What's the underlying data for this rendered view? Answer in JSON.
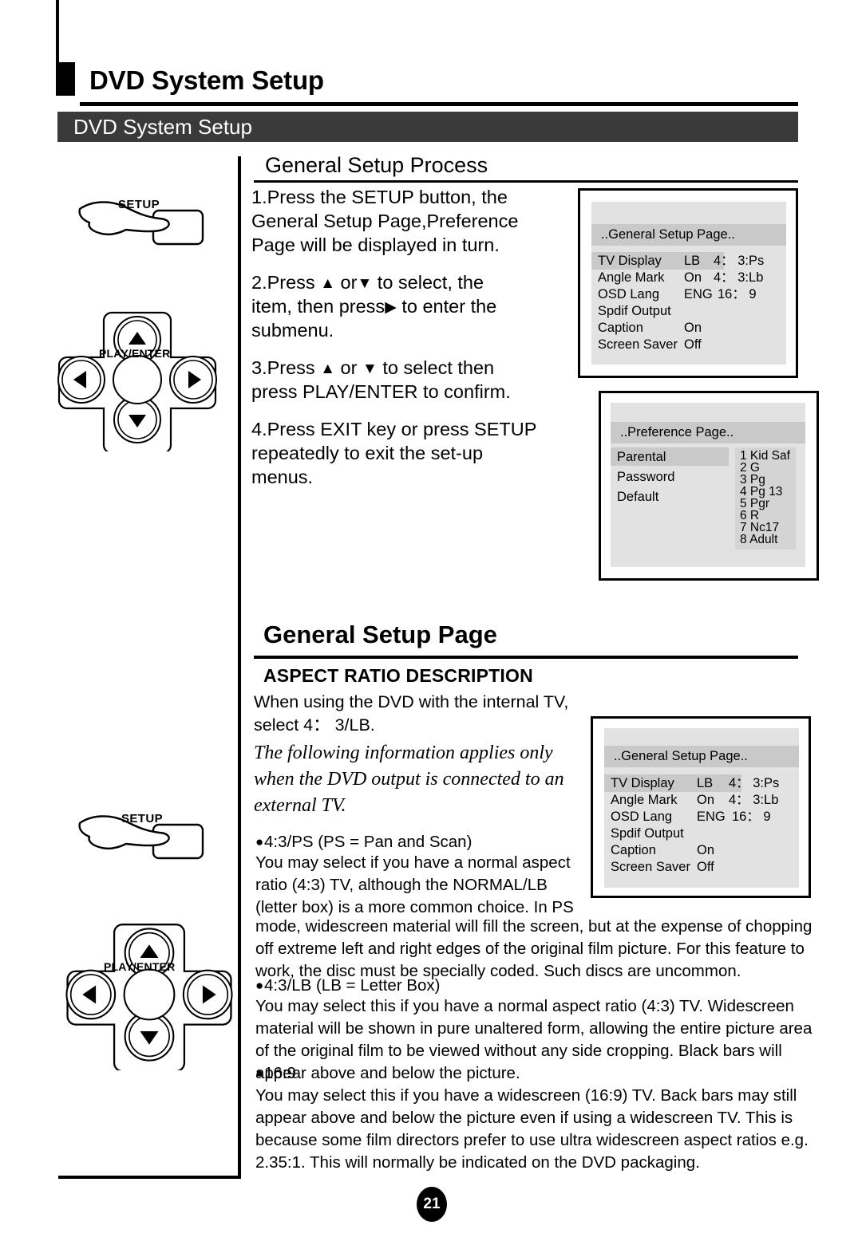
{
  "page": {
    "number": "21",
    "doc_title": "DVD System Setup",
    "title_bar_label": "DVD System Setup"
  },
  "process_section": {
    "heading": "General Setup Process",
    "steps": [
      {
        "id": "step-1",
        "line1": "1.Press the SETUP button, the",
        "line2": "General Setup Page,Preference",
        "line3": "Page  will be displayed in turn."
      },
      {
        "id": "step-2",
        "pre": "2.Press",
        "up": "▲",
        "or": "or",
        "down": "▼",
        "mid": "to select, the",
        "line2a": "item, then press",
        "right": "▶",
        "line2b": "to enter the",
        "line3": "submenu."
      },
      {
        "id": "step-3",
        "pre": "3.Press",
        "up": "▲",
        "or": "or",
        "down": "▼",
        "mid": "to select  then",
        "line2": "press PLAY/ENTER to confirm."
      },
      {
        "id": "step-4",
        "line1": "4.Press  EXIT key or press SETUP",
        "line2": "repeatedly  to  exit  the  set-up",
        "line3": "menus."
      }
    ]
  },
  "remote_top": {
    "setup_label": "SETUP",
    "dpad_label": "PLAY/ENTER",
    "up": "▲",
    "down": "▼",
    "left": "◀",
    "right": "▶"
  },
  "remote_bottom": {
    "setup_label": "SETUP",
    "dpad_label": "PLAY/ENTER",
    "up": "▲",
    "down": "▼",
    "left": "◀",
    "right": "▶"
  },
  "osd_general_1": {
    "title": "..General Setup Page..",
    "rows": [
      {
        "label": "TV Display",
        "value": "LB",
        "option": "4： 3:Ps",
        "highlight": true
      },
      {
        "label": "Angle Mark",
        "value": "On",
        "option": "4： 3:Lb",
        "highlight": false
      },
      {
        "label": "OSD Lang",
        "value": "ENG",
        "option": "16： 9",
        "highlight": false
      },
      {
        "label": "Spdif Output",
        "value": "",
        "option": "",
        "highlight": false
      },
      {
        "label": "Caption",
        "value": "On",
        "option": "",
        "highlight": false
      },
      {
        "label": "Screen Saver",
        "value": "Off",
        "option": "",
        "highlight": false
      }
    ]
  },
  "osd_preference": {
    "title": "..Preference Page..",
    "rows": [
      {
        "label": "Parental",
        "highlight": true
      },
      {
        "label": "Password",
        "highlight": false
      },
      {
        "label": "Default",
        "highlight": false
      }
    ],
    "ratings": [
      "1 Kid Saf",
      "2 G",
      "3 Pg",
      "4 Pg 13",
      "5 Pgr",
      "6 R",
      "7 Nc17",
      "8 Adult"
    ]
  },
  "osd_general_2": {
    "title": "..General Setup Page..",
    "rows": [
      {
        "label": "TV Display",
        "value": "LB",
        "option": "4： 3:Ps",
        "highlight": true
      },
      {
        "label": "Angle Mark",
        "value": "On",
        "option": "4： 3:Lb",
        "highlight": false
      },
      {
        "label": "OSD Lang",
        "value": "ENG",
        "option": "16： 9",
        "highlight": false
      },
      {
        "label": "Spdif Output",
        "value": "",
        "option": "",
        "highlight": false
      },
      {
        "label": "Caption",
        "value": "On",
        "option": "",
        "highlight": false
      },
      {
        "label": "Screen Saver",
        "value": "Off",
        "option": "",
        "highlight": false
      }
    ]
  },
  "aspect_section": {
    "page_heading": "General Setup Page",
    "sub_heading": "ASPECT RATIO DESCRIPTION",
    "intro_line1": "When using the DVD with the internal TV,",
    "intro_line2": "select 4： 3/LB.",
    "italic_note": "The following information applies only when the DVD output is connected to an external TV.",
    "ps_bullet": "4:3/PS (PS = Pan and Scan)",
    "ps_narrow": "You may select if you have a normal aspect ratio (4:3) TV, although the NORMAL/LB (letter box) is a more common choice. In PS",
    "ps_wide": "mode, widescreen material will fill the screen, but at the expense of chopping off extreme left and right edges of the original film picture. For this feature to work, the disc must be specially coded. Such discs are uncommon.",
    "lb_bullet": "4:3/LB (LB = Letter Box)",
    "lb_body": "You may select this if you have a normal aspect ratio (4:3) TV. Widescreen material will be shown in pure unaltered form, allowing the entire picture area of the original film to be viewed without any side cropping. Black bars will appear above and below the picture.",
    "wide_bullet": "16:9",
    "wide_body": "You may select this if you have a widescreen (16:9) TV. Back bars may still appear above and below the picture even if using a widescreen TV. This is because some film directors prefer to use ultra widescreen aspect ratios e.g. 2.35:1. This will normally be indicated on the DVD packaging."
  }
}
